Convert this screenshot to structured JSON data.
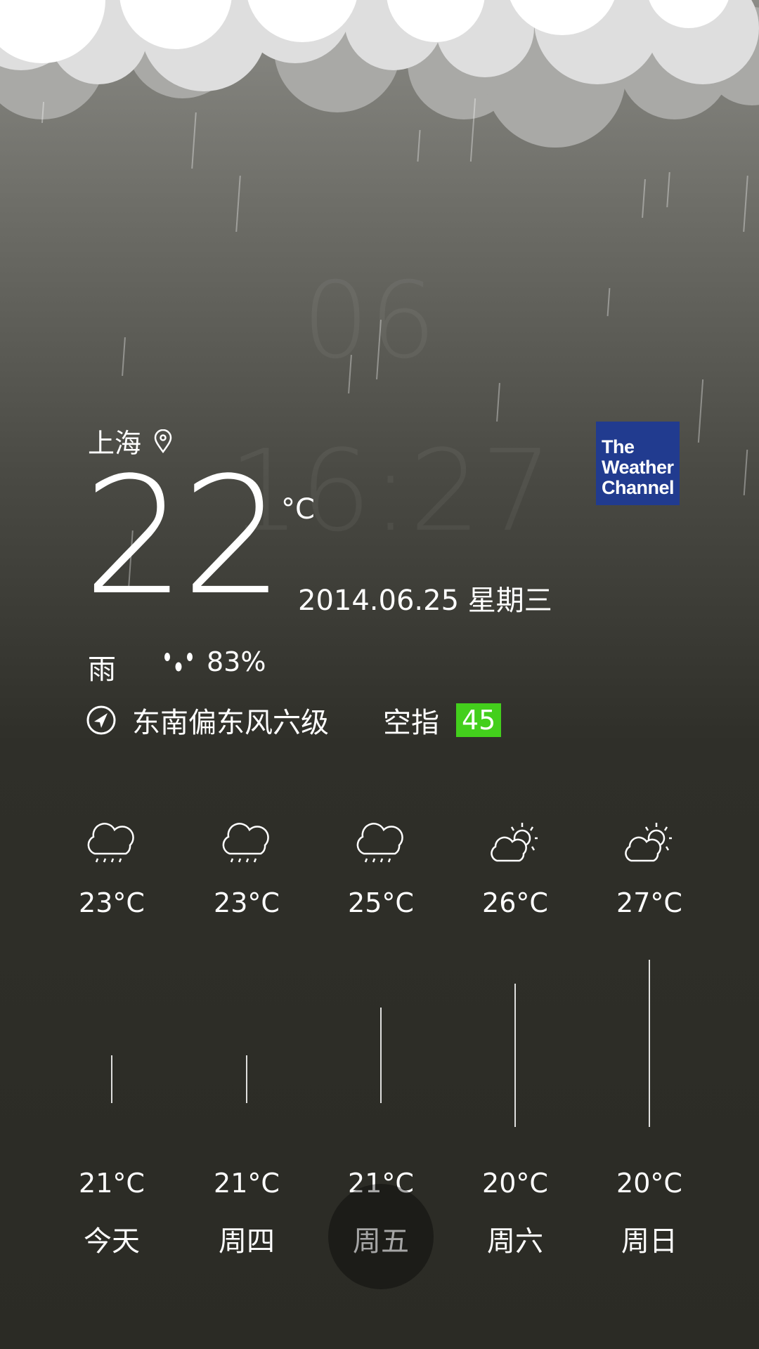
{
  "background_clock": {
    "month": "06",
    "time": "16:27"
  },
  "current": {
    "city": "上海",
    "temperature": "22",
    "unit": "°C",
    "date": "2014.06.25  星期三",
    "condition": "雨",
    "humidity": "83%",
    "wind": "东南偏东风六级",
    "aqi_label": "空指",
    "aqi_value": "45",
    "aqi_color": "#43cf1c"
  },
  "provider_logo": {
    "text_lines": [
      "The",
      "Weather",
      "Channel"
    ],
    "color": "#213b8f"
  },
  "forecast": [
    {
      "day": "今天",
      "icon": "rain-icon",
      "high": "23°C",
      "low": "21°C",
      "high_value": 23,
      "low_value": 21
    },
    {
      "day": "周四",
      "icon": "rain-icon",
      "high": "23°C",
      "low": "21°C",
      "high_value": 23,
      "low_value": 21
    },
    {
      "day": "周五",
      "icon": "rain-icon",
      "high": "25°C",
      "low": "21°C",
      "high_value": 25,
      "low_value": 21
    },
    {
      "day": "周六",
      "icon": "partly-cloudy-icon",
      "high": "26°C",
      "low": "20°C",
      "high_value": 26,
      "low_value": 20
    },
    {
      "day": "周日",
      "icon": "partly-cloudy-icon",
      "high": "27°C",
      "low": "20°C",
      "high_value": 27,
      "low_value": 20
    }
  ]
}
